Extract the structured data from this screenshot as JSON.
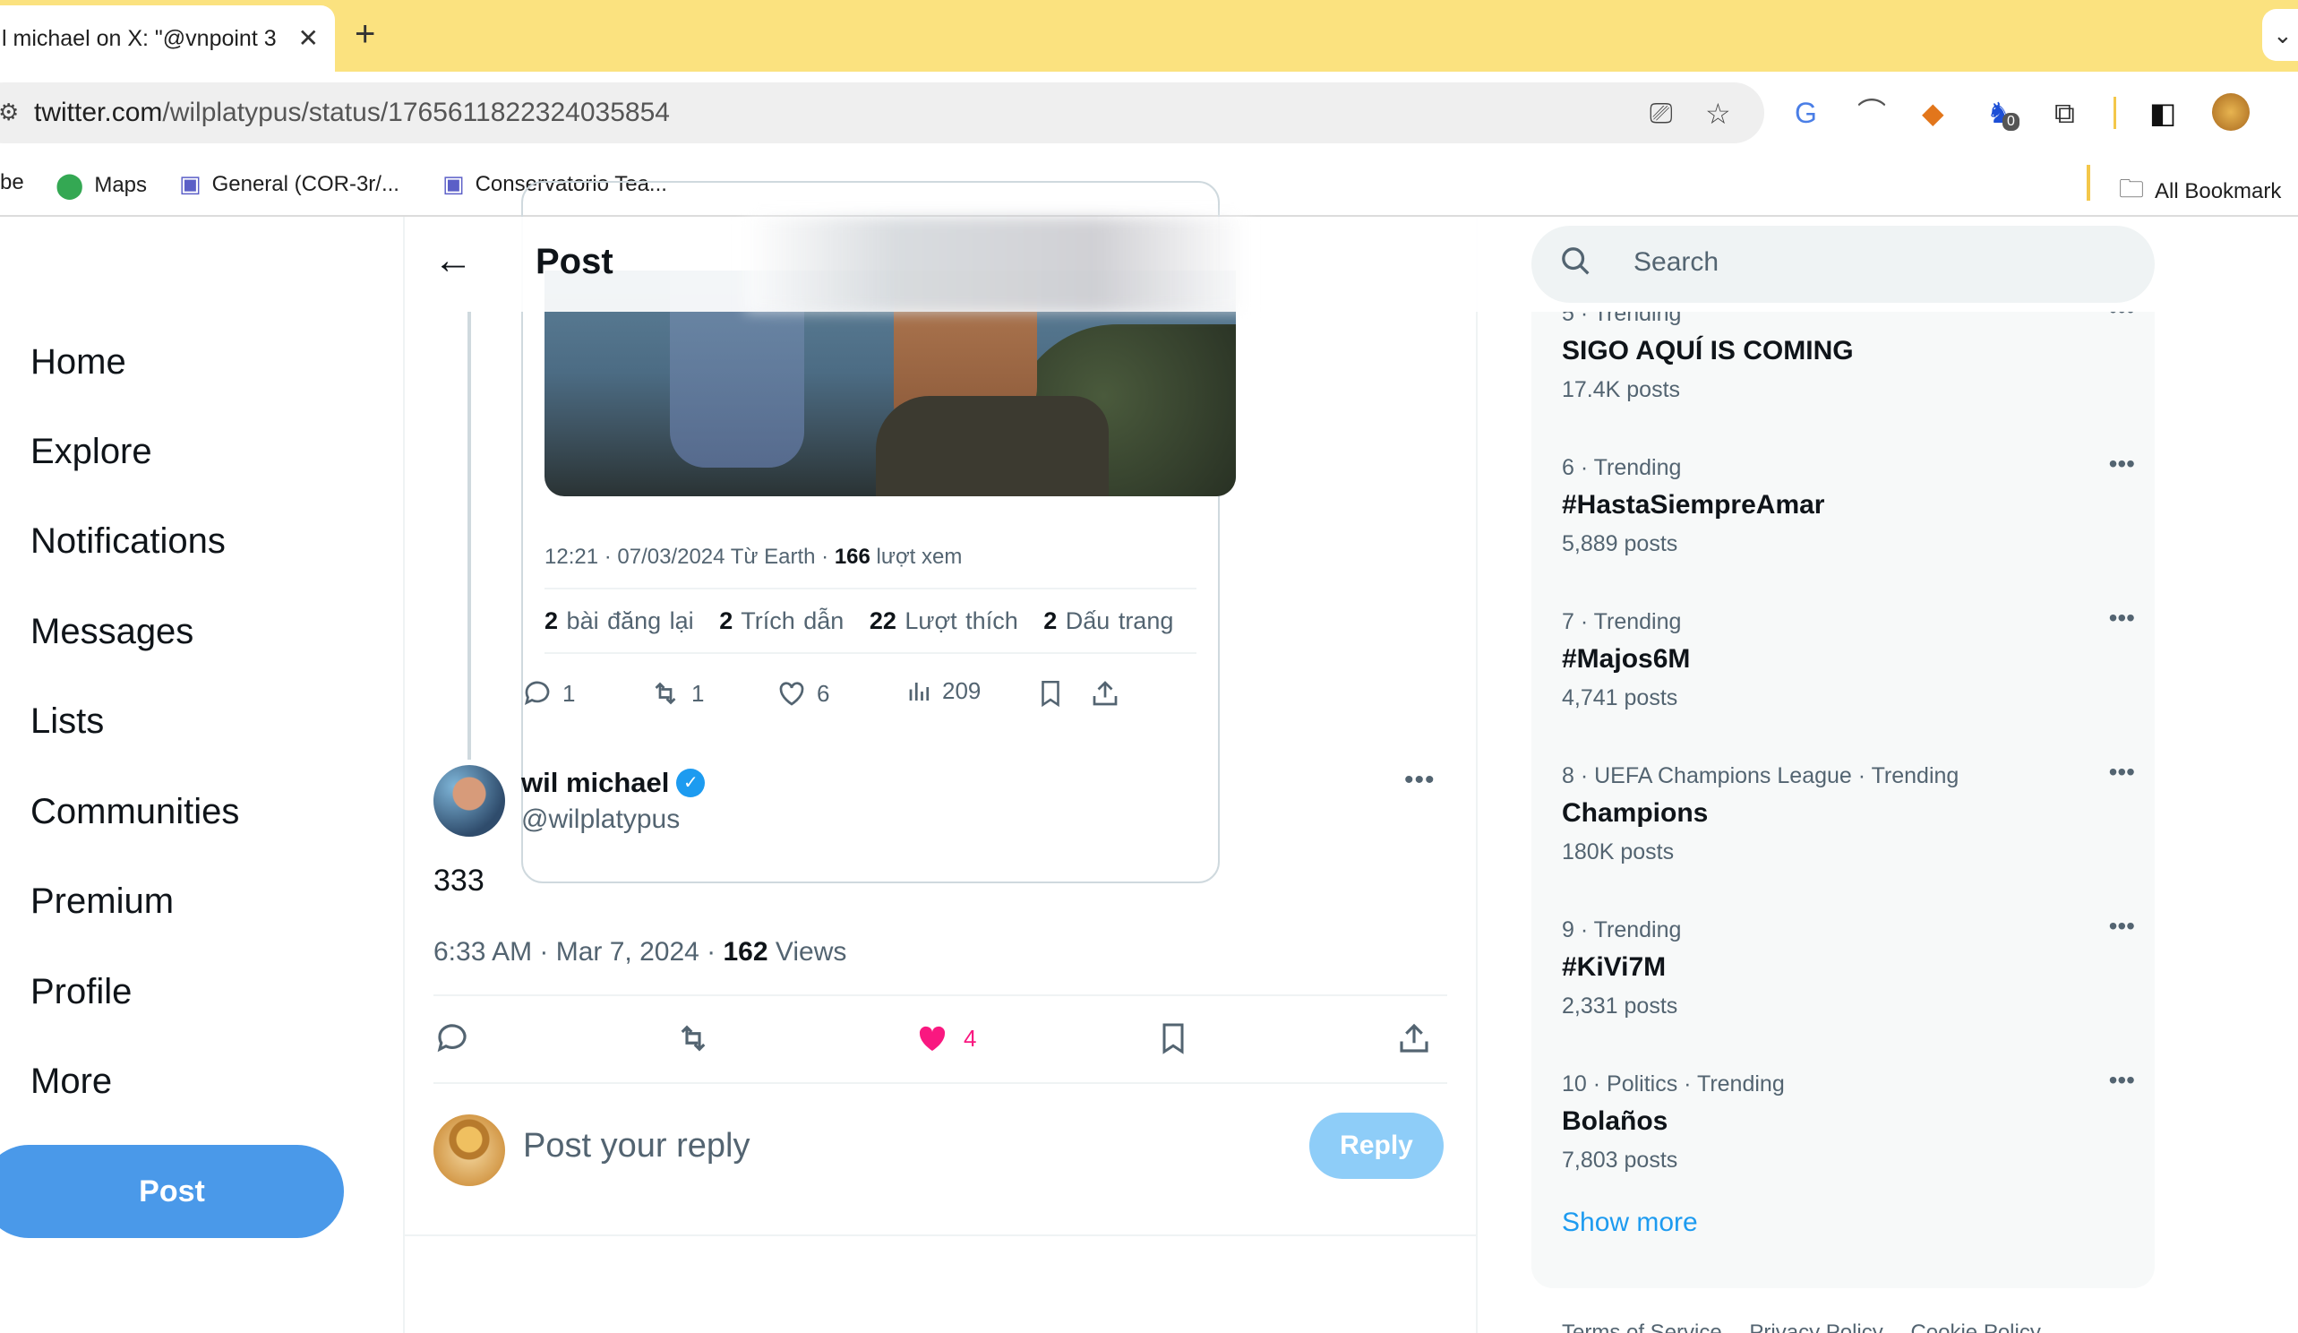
{
  "browser": {
    "tab_title": "l michael on X: \"@vnpoint 3",
    "url_host": "twitter.com",
    "url_path": "/wilplatypus/status/1765611822324035854",
    "bookmarks": [
      {
        "label": "be"
      },
      {
        "label": "Maps"
      },
      {
        "label": "General (COR-3r/..."
      },
      {
        "label": "Conservatorio Tea..."
      }
    ],
    "all_bookmarks": "All Bookmark",
    "extension_badge": "0"
  },
  "nav": {
    "items": [
      "Home",
      "Explore",
      "Notifications",
      "Messages",
      "Lists",
      "Communities",
      "Premium",
      "Profile",
      "More"
    ],
    "post_button": "Post"
  },
  "header": {
    "title": "Post"
  },
  "quoted": {
    "meta_time": "12:21 · 07/03/2024 Từ Earth · ",
    "meta_views_count": "166",
    "meta_views_label": " lượt xem",
    "stats": [
      {
        "count": "2",
        "label": "bài đăng lại"
      },
      {
        "count": "2",
        "label": "Trích dẫn"
      },
      {
        "count": "22",
        "label": "Lượt thích"
      },
      {
        "count": "2",
        "label": "Dấu trang"
      }
    ]
  },
  "parent_actions": {
    "replies": "1",
    "reposts": "1",
    "likes": "6",
    "views": "209"
  },
  "tweet": {
    "author_name": "wil michael",
    "author_handle": "@wilplatypus",
    "text": "333",
    "time": "6:33 AM · Mar 7, 2024 · ",
    "views_count": "162",
    "views_label": " Views",
    "likes": "4"
  },
  "reply": {
    "placeholder": "Post your reply",
    "button": "Reply"
  },
  "search": {
    "placeholder": "Search"
  },
  "trends": [
    {
      "context": "5 · Trending",
      "name": "SIGO AQUÍ IS COMING",
      "posts": "17.4K posts"
    },
    {
      "context": "6 · Trending",
      "name": "#HastaSiempreAmar",
      "posts": "5,889 posts"
    },
    {
      "context": "7 · Trending",
      "name": "#Majos6M",
      "posts": "4,741 posts"
    },
    {
      "context": "8 · UEFA Champions League · Trending",
      "name": "Champions",
      "posts": "180K posts"
    },
    {
      "context": "9 · Trending",
      "name": "#KiVi7M",
      "posts": "2,331 posts"
    },
    {
      "context": "10 · Politics · Trending",
      "name": "Bolaños",
      "posts": "7,803 posts"
    }
  ],
  "show_more": "Show more",
  "footer": [
    "Terms of Service",
    "Privacy Policy",
    "Cookie Policy"
  ],
  "colors": {
    "accent": "#1d9bf0",
    "post_button": "#4a99e9",
    "like": "#f91880",
    "tabstrip": "#fbe27f"
  }
}
